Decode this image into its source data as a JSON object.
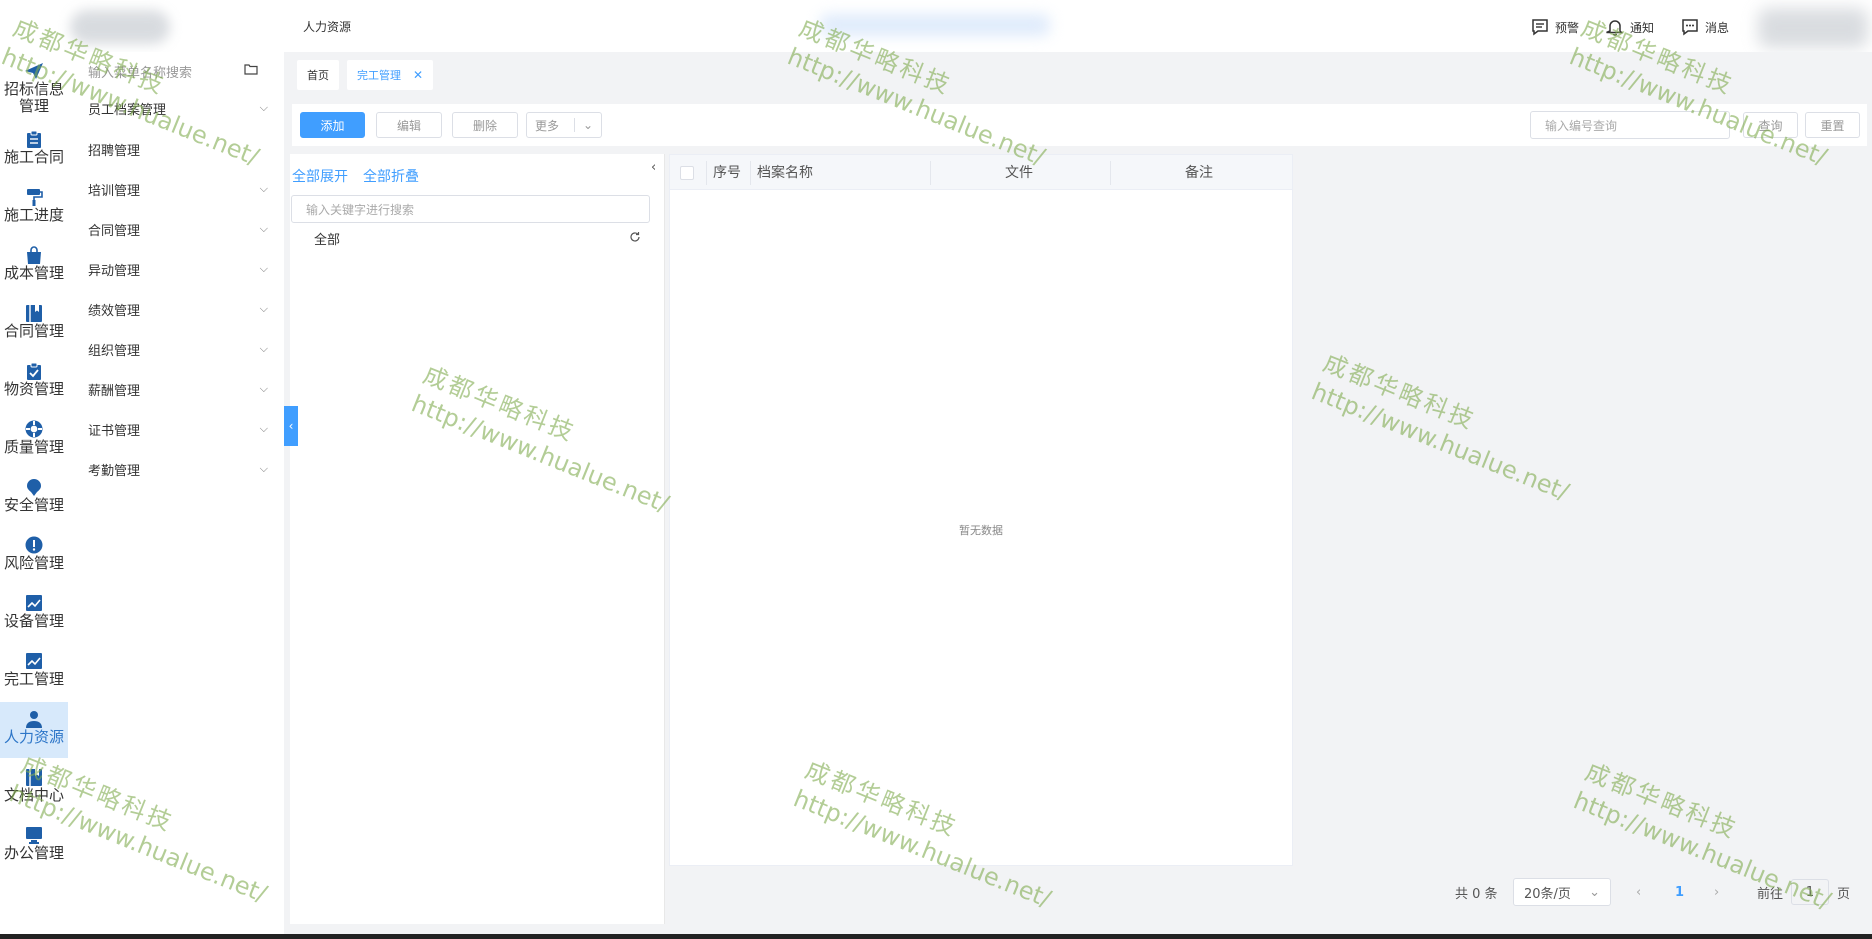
{
  "header": {
    "breadcrumb": "人力资源",
    "actions": [
      {
        "icon": "alert-message-icon",
        "label": "预警"
      },
      {
        "icon": "bell-icon",
        "label": "通知"
      },
      {
        "icon": "chat-bubble-icon",
        "label": "消息"
      }
    ]
  },
  "nav": {
    "items": [
      {
        "label": "招标信息管理",
        "icon": "paper-plane-icon"
      },
      {
        "label": "施工合同",
        "icon": "clipboard-icon"
      },
      {
        "label": "施工进度",
        "icon": "paint-roller-icon"
      },
      {
        "label": "成本管理",
        "icon": "shopping-bag-icon"
      },
      {
        "label": "合同管理",
        "icon": "book-icon"
      },
      {
        "label": "物资管理",
        "icon": "clipboard-check-icon"
      },
      {
        "label": "质量管理",
        "icon": "life-ring-icon"
      },
      {
        "label": "安全管理",
        "icon": "map-pin-icon"
      },
      {
        "label": "风险管理",
        "icon": "exclamation-circle-icon"
      },
      {
        "label": "设备管理",
        "icon": "line-chart-icon"
      },
      {
        "label": "完工管理",
        "icon": "line-chart-icon"
      },
      {
        "label": "人力资源",
        "icon": "user-icon",
        "active": true
      },
      {
        "label": "文档中心",
        "icon": "book-icon"
      },
      {
        "label": "办公管理",
        "icon": "monitor-icon"
      }
    ]
  },
  "submenu": {
    "search_placeholder": "输入菜单名称搜索",
    "items": [
      {
        "label": "员工档案管理",
        "expandable": true
      },
      {
        "label": "招聘管理",
        "expandable": false
      },
      {
        "label": "培训管理",
        "expandable": true
      },
      {
        "label": "合同管理",
        "expandable": true
      },
      {
        "label": "异动管理",
        "expandable": true
      },
      {
        "label": "绩效管理",
        "expandable": true
      },
      {
        "label": "组织管理",
        "expandable": true
      },
      {
        "label": "薪酬管理",
        "expandable": true
      },
      {
        "label": "证书管理",
        "expandable": true
      },
      {
        "label": "考勤管理",
        "expandable": true
      }
    ]
  },
  "tabs": [
    {
      "label": "首页",
      "active": false
    },
    {
      "label": "完工管理",
      "active": true,
      "closable": true
    }
  ],
  "toolbar": {
    "add": "添加",
    "edit": "编辑",
    "delete": "删除",
    "more": "更多",
    "search_placeholder": "输入编号查询",
    "query": "查询",
    "reset": "重置"
  },
  "tree": {
    "expand_all": "全部展开",
    "collapse_all": "全部折叠",
    "search_placeholder": "输入关键字进行搜索",
    "root": "全部"
  },
  "table": {
    "columns": [
      "序号",
      "档案名称",
      "文件",
      "备注"
    ],
    "empty_text": "暂无数据"
  },
  "pagination": {
    "total": "共 0 条",
    "page_size": "20条/页",
    "current_page": "1",
    "goto_label": "前往",
    "goto_value": "1",
    "page_unit": "页"
  },
  "watermark": {
    "company": "成都华略科技",
    "url": "http://www.hualue.net/"
  },
  "colors": {
    "primary": "#409eff",
    "nav_icon": "#1f5fa8",
    "active_bg": "#d7e9fb",
    "watermark": "#80ac50"
  }
}
